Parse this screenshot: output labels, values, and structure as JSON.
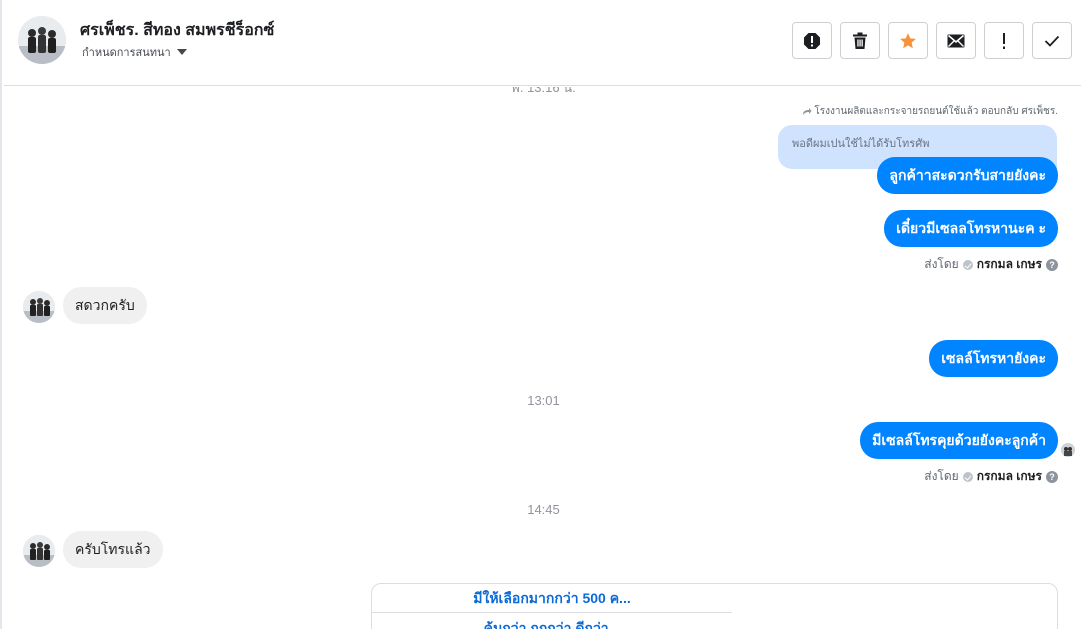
{
  "header": {
    "contact_name": "ศรเพ็ชร. สีทอง สมพรชีร็อกซ์",
    "assign_label": "กำหนดการสนทนา",
    "tools": [
      {
        "name": "spam-icon",
        "label": "!"
      },
      {
        "name": "trash-icon",
        "label": ""
      },
      {
        "name": "star-icon",
        "label": ""
      },
      {
        "name": "envelope-icon",
        "label": ""
      },
      {
        "name": "exclamation-icon",
        "label": "!"
      },
      {
        "name": "check-icon",
        "label": ""
      }
    ],
    "star_color": "#f7923b"
  },
  "thread": {
    "cut_timestamp": "พ. 13:16 น.",
    "reply_note": "โรงงานผลิตและกระจายรถยนต์ใช้แล้ว ตอบกลับ ศรเพ็ชร.",
    "quoted_text": "พอดีผมเปนใช้ไม่ได้รับโทรศัพ",
    "messages": {
      "out1": "ลูกค้าาสะดวกรับสายยังคะ",
      "out2": "เดี๋ยวมีเซลลโทรหานะค ะ",
      "in1": "สดวกครับ",
      "out3": "เซลล์โทรหายังคะ",
      "out4": "มีเซลล์โทรคุยด้วยยังคะลูกค้า",
      "in2": "ครับโทรแล้ว"
    },
    "sent_by_prefix": "ส่งโดย",
    "sent_by_name": "กรกมล เกษร",
    "timestamps": {
      "t1": "13:01",
      "t2": "14:45"
    },
    "card": {
      "row1": "มีให้เลือกมากกว่า 500 ค...",
      "row2": "คุ้มกว่า ถูกกว่า ดีกว่า..."
    },
    "accent_color": "#0084ff"
  }
}
